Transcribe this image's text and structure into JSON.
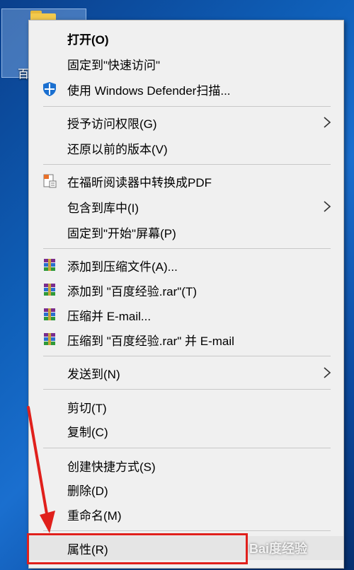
{
  "desktop": {
    "icon_label": "百"
  },
  "menu": {
    "groups": [
      [
        "打开(O)",
        "固定到\"快速访问\"",
        "使用 Windows Defender扫描..."
      ],
      [
        "授予访问权限(G)",
        "还原以前的版本(V)"
      ],
      [
        "在福昕阅读器中转换成PDF",
        "包含到库中(I)",
        "固定到\"开始\"屏幕(P)"
      ],
      [
        "添加到压缩文件(A)...",
        "添加到 \"百度经验.rar\"(T)",
        "压缩并 E-mail...",
        "压缩到 \"百度经验.rar\" 并 E-mail"
      ],
      [
        "发送到(N)"
      ],
      [
        "剪切(T)",
        "复制(C)"
      ],
      [
        "创建快捷方式(S)",
        "删除(D)",
        "重命名(M)"
      ],
      [
        "属性(R)"
      ]
    ]
  },
  "watermark": {
    "text": "Bai度经验"
  },
  "colors": {
    "menu_bg": "#f0f0f0",
    "highlight": "#e0201c",
    "defender": "#1a6fd0"
  }
}
